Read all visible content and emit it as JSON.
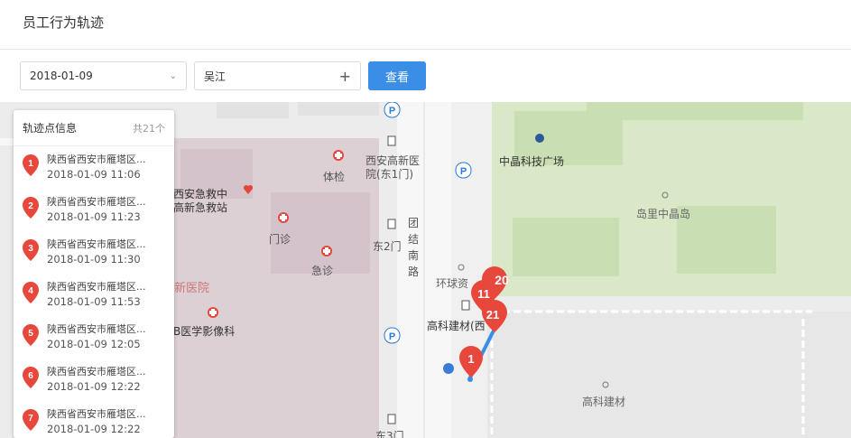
{
  "page_title": "员工行为轨迹",
  "filters": {
    "date": "2018-01-09",
    "employee": "吴江",
    "search_label": "查看"
  },
  "panel": {
    "title": "轨迹点信息",
    "count": "共21个",
    "items": [
      {
        "num": "1",
        "addr": "陕西省西安市雁塔区...",
        "time": "2018-01-09 11:06"
      },
      {
        "num": "2",
        "addr": "陕西省西安市雁塔区...",
        "time": "2018-01-09 11:23"
      },
      {
        "num": "3",
        "addr": "陕西省西安市雁塔区...",
        "time": "2018-01-09 11:30"
      },
      {
        "num": "4",
        "addr": "陕西省西安市雁塔区...",
        "time": "2018-01-09 11:53"
      },
      {
        "num": "5",
        "addr": "陕西省西安市雁塔区...",
        "time": "2018-01-09 12:05"
      },
      {
        "num": "6",
        "addr": "陕西省西安市雁塔区...",
        "time": "2018-01-09 12:22"
      },
      {
        "num": "7",
        "addr": "陕西省西安市雁塔区...",
        "time": "2018-01-09 12:22"
      }
    ]
  },
  "map": {
    "labels": {
      "l1": "体检",
      "l2": "西安高新医",
      "l3": "院(东1门)",
      "l4": "西安急救中",
      "l5": "高新急救站",
      "l6": "门诊",
      "l7": "东2门",
      "l8": "团",
      "l9": "结",
      "l10": "南",
      "l11": "路",
      "l12": "急诊",
      "l13": "新医院",
      "l14": "B医学影像科",
      "l15": "中晶科技广场",
      "l16": "岛里中晶岛",
      "l17": "环球资",
      "l18": "高科建材(西",
      "l19": "高科建材",
      "l20": "东3门"
    },
    "markers": [
      "1",
      "11",
      "20",
      "21"
    ],
    "accent": "#e8473c"
  }
}
